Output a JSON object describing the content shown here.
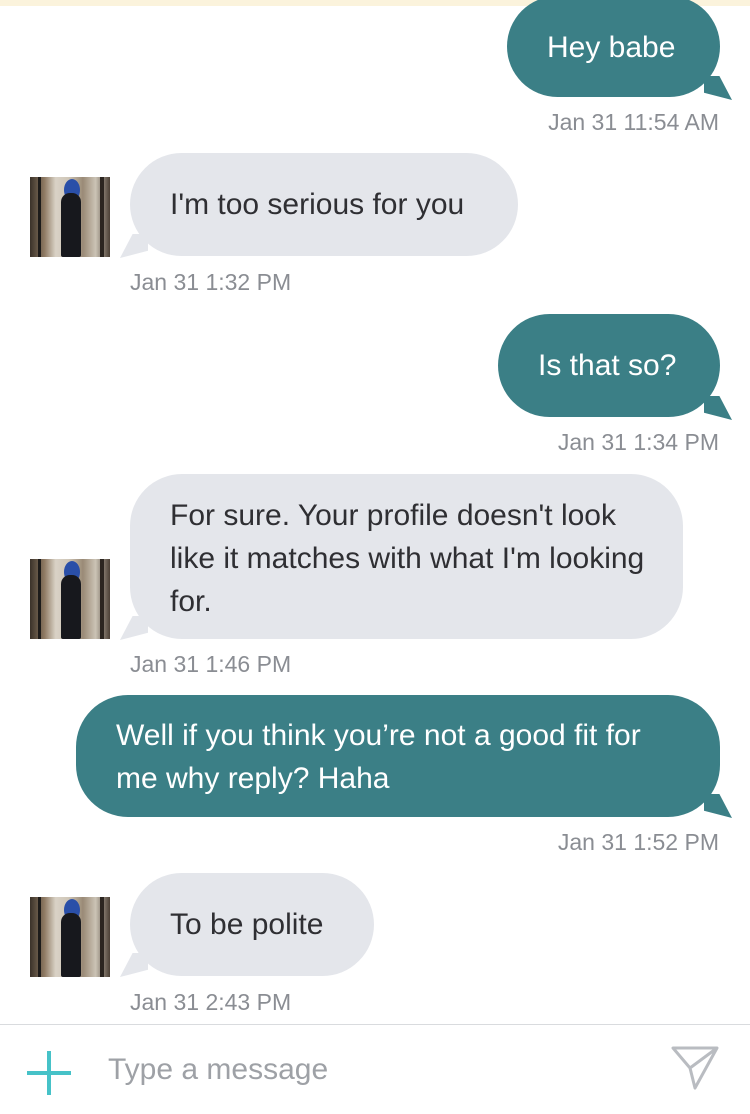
{
  "thread": {
    "messages": [
      {
        "direction": "outgoing",
        "text": "Hey babe",
        "timestamp": "Jan 31 11:54 AM"
      },
      {
        "direction": "incoming",
        "text": "I'm too serious for you",
        "timestamp": "Jan 31 1:32 PM"
      },
      {
        "direction": "outgoing",
        "text": "Is that so?",
        "timestamp": "Jan 31 1:34 PM"
      },
      {
        "direction": "incoming",
        "text": "For sure. Your profile doesn't look like it matches with what I'm looking for.",
        "timestamp": "Jan 31 1:46 PM"
      },
      {
        "direction": "outgoing",
        "text": "Well if you think you’re not a good fit for me why reply? Haha",
        "timestamp": "Jan 31 1:52 PM"
      },
      {
        "direction": "incoming",
        "text": "To be polite",
        "timestamp": "Jan 31 2:43 PM"
      }
    ]
  },
  "composer": {
    "placeholder": "Type a message",
    "value": "",
    "add_icon": "plus-icon",
    "send_icon": "send-icon"
  },
  "colors": {
    "outgoing_bubble": "#3b7f86",
    "incoming_bubble": "#e4e6eb",
    "accent": "#46c2c8",
    "timestamp": "#8a8d93"
  }
}
